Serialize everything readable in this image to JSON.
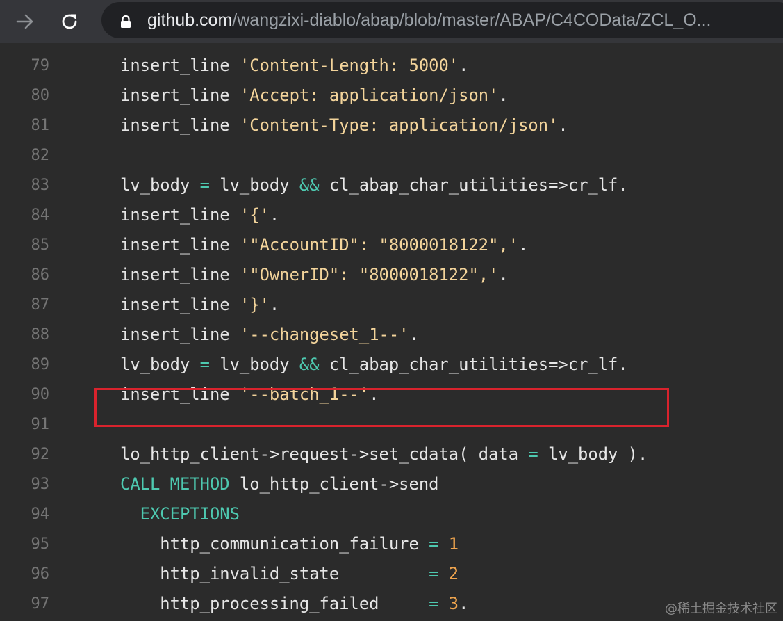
{
  "browser": {
    "url_host": "github.com",
    "url_path": "/wangzixi-diablo/abap/blob/master/ABAP/C4COData/ZCL_O..."
  },
  "code": {
    "lines": [
      {
        "num": "79",
        "tokens": [
          [
            "insert_line ",
            "p"
          ],
          [
            "'Content-Length: 5000'",
            "s"
          ],
          [
            ".",
            "p"
          ]
        ]
      },
      {
        "num": "80",
        "tokens": [
          [
            "insert_line ",
            "p"
          ],
          [
            "'Accept: application/json'",
            "s"
          ],
          [
            ".",
            "p"
          ]
        ]
      },
      {
        "num": "81",
        "tokens": [
          [
            "insert_line ",
            "p"
          ],
          [
            "'Content-Type: application/json'",
            "s"
          ],
          [
            ".",
            "p"
          ]
        ]
      },
      {
        "num": "82",
        "tokens": []
      },
      {
        "num": "83",
        "tokens": [
          [
            "lv_body ",
            "p"
          ],
          [
            "=",
            "o"
          ],
          [
            " lv_body ",
            "p"
          ],
          [
            "&&",
            "o"
          ],
          [
            " cl_abap_char_utilities=>cr_lf.",
            "p"
          ]
        ]
      },
      {
        "num": "84",
        "tokens": [
          [
            "insert_line ",
            "p"
          ],
          [
            "'{'",
            "s"
          ],
          [
            ".",
            "p"
          ]
        ]
      },
      {
        "num": "85",
        "tokens": [
          [
            "insert_line ",
            "p"
          ],
          [
            "'\"AccountID\": \"8000018122\",'",
            "s"
          ],
          [
            ".",
            "p"
          ]
        ]
      },
      {
        "num": "86",
        "tokens": [
          [
            "insert_line ",
            "p"
          ],
          [
            "'\"OwnerID\": \"8000018122\",'",
            "s"
          ],
          [
            ".",
            "p"
          ]
        ]
      },
      {
        "num": "87",
        "tokens": [
          [
            "insert_line ",
            "p"
          ],
          [
            "'}'",
            "s"
          ],
          [
            ".",
            "p"
          ]
        ]
      },
      {
        "num": "88",
        "tokens": [
          [
            "insert_line ",
            "p"
          ],
          [
            "'--changeset_1--'",
            "s"
          ],
          [
            ".",
            "p"
          ]
        ]
      },
      {
        "num": "89",
        "tokens": [
          [
            "lv_body ",
            "p"
          ],
          [
            "=",
            "o"
          ],
          [
            " lv_body ",
            "p"
          ],
          [
            "&&",
            "o"
          ],
          [
            " cl_abap_char_utilities=>cr_lf.",
            "p"
          ]
        ]
      },
      {
        "num": "90",
        "tokens": [
          [
            "insert_line ",
            "p"
          ],
          [
            "'--batch_1--'",
            "s"
          ],
          [
            ".",
            "p"
          ]
        ]
      },
      {
        "num": "91",
        "tokens": []
      },
      {
        "num": "92",
        "tokens": [
          [
            "lo_http_client->request->set_cdata( data ",
            "p"
          ],
          [
            "=",
            "o"
          ],
          [
            " lv_body ).",
            "p"
          ]
        ]
      },
      {
        "num": "93",
        "tokens": [
          [
            "CALL METHOD",
            "k"
          ],
          [
            " lo_http_client->send",
            "p"
          ]
        ]
      },
      {
        "num": "94",
        "tokens": [
          [
            "  ",
            "p"
          ],
          [
            "EXCEPTIONS",
            "k"
          ]
        ]
      },
      {
        "num": "95",
        "tokens": [
          [
            "    http_communication_failure ",
            "p"
          ],
          [
            "=",
            "o"
          ],
          [
            " ",
            "p"
          ],
          [
            "1",
            "n"
          ]
        ]
      },
      {
        "num": "96",
        "tokens": [
          [
            "    http_invalid_state         ",
            "p"
          ],
          [
            "=",
            "o"
          ],
          [
            " ",
            "p"
          ],
          [
            "2",
            "n"
          ]
        ]
      },
      {
        "num": "97",
        "tokens": [
          [
            "    http_processing_failed     ",
            "p"
          ],
          [
            "=",
            "o"
          ],
          [
            " ",
            "p"
          ],
          [
            "3",
            "n"
          ],
          [
            ".",
            "p"
          ]
        ]
      }
    ],
    "highlighted_line": "92"
  },
  "watermark": "@稀土掘金技术社区",
  "colors": {
    "background": "#2b2b2b",
    "plain": "#e6e6e6",
    "string": "#f3d49b",
    "operator": "#4ec9b0",
    "keyword": "#4ec9b0",
    "number": "#f0a54e",
    "highlight_border": "#d9232d"
  }
}
